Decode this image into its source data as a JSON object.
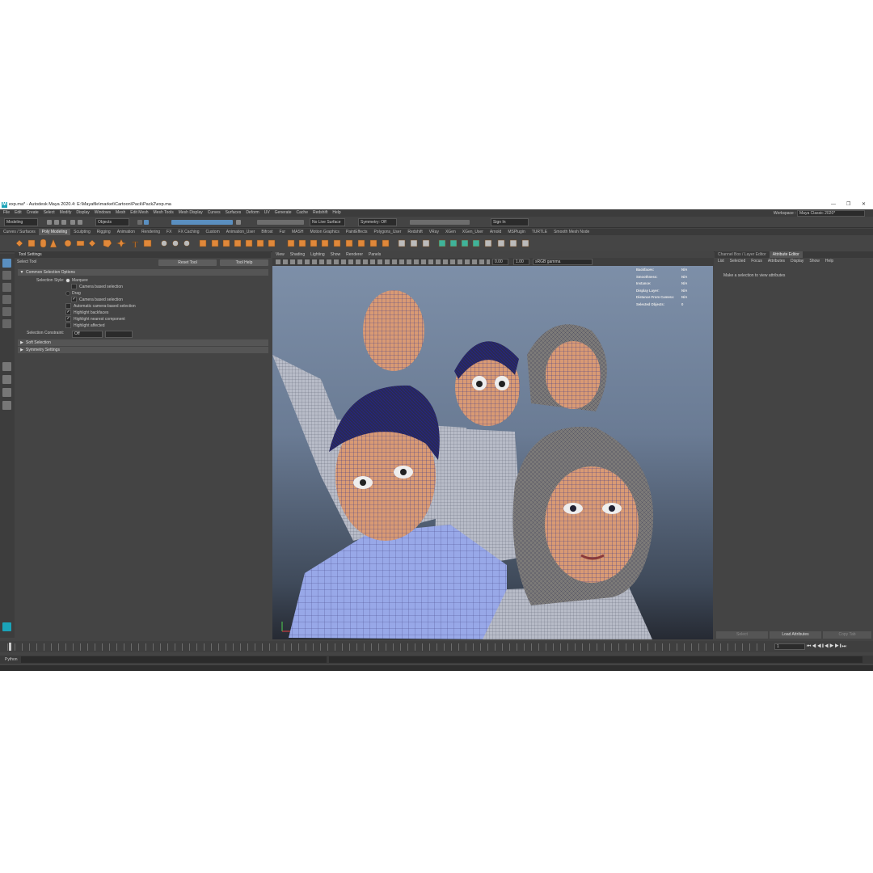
{
  "window": {
    "title": "exp.ma* - Autodesk Maya 2020.4: E:\\Mayafile\\market\\Cartoon\\Pack\\Pack2\\exp.ma",
    "logo": "M",
    "minimize": "—",
    "restore": "❐",
    "close": "✕"
  },
  "menu": [
    "File",
    "Edit",
    "Create",
    "Select",
    "Modify",
    "Display",
    "Windows",
    "Mesh",
    "Edit Mesh",
    "Mesh Tools",
    "Mesh Display",
    "Curves",
    "Surfaces",
    "Deform",
    "UV",
    "Generate",
    "Cache",
    "Redshift",
    "Help"
  ],
  "workspace": {
    "label": "Workspace :",
    "value": "Maya Classic 2020*"
  },
  "status": {
    "mode": "Modeling",
    "objects": "Objects",
    "live_surface": "No Live Surface",
    "symmetry": "Symmetry: Off",
    "sign_in": "Sign In"
  },
  "shelf_tabs": [
    "Curves / Surfaces",
    "Poly Modeling",
    "Sculpting",
    "Rigging",
    "Animation",
    "Rendering",
    "FX",
    "FX Caching",
    "Custom",
    "Animation_User",
    "Bifrost",
    "Fur",
    "MASH",
    "Motion Graphics",
    "PaintEffects",
    "Polygons_User",
    "Redshift",
    "VRay",
    "XGen",
    "XGen_User",
    "Arnold",
    "MSPlugin",
    "TURTLE",
    "Smooth Mesh Node"
  ],
  "active_shelf": "Poly Modeling",
  "tool_settings": {
    "panel_title": "Tool Settings",
    "tool_name": "Select Tool",
    "reset": "Reset Tool",
    "help": "Tool Help",
    "frame1": "Common Selection Options",
    "style_label": "Selection Style:",
    "opt_marquee": "Marquee",
    "opt_camera1": "Camera based selection",
    "opt_drag": "Drag",
    "opt_camera2": "Camera based selection",
    "opt_auto": "Automatic camera-based selection",
    "opt_backfaces": "Highlight backfaces",
    "opt_nearest": "Highlight nearest component",
    "opt_affected": "Highlight affected",
    "constraint_label": "Selection Constraint:",
    "constraint_value": "Off",
    "frame2": "Soft Selection",
    "frame3": "Symmetry Settings"
  },
  "viewport": {
    "menu": [
      "View",
      "Shading",
      "Lighting",
      "Show",
      "Renderer",
      "Panels"
    ],
    "exposure": "0.00",
    "gamma": "1.00",
    "colorspace": "sRGB gamma",
    "hud": [
      {
        "k": "Backfaces:",
        "v": "N/A"
      },
      {
        "k": "Smoothness:",
        "v": "N/A"
      },
      {
        "k": "Instance:",
        "v": "N/A"
      },
      {
        "k": "Display Layer:",
        "v": "N/A"
      },
      {
        "k": "Distance From Camera:",
        "v": "N/A"
      },
      {
        "k": "Selected Objects:",
        "v": "0"
      }
    ]
  },
  "attribute_editor": {
    "tabs": [
      "Channel Box / Layer Editor",
      "Attribute Editor"
    ],
    "menu": [
      "List",
      "Selected",
      "Focus",
      "Attributes",
      "Display",
      "Show",
      "Help"
    ],
    "empty_msg": "Make a selection to view attributes",
    "buttons": [
      "Select",
      "Load Attributes",
      "Copy Tab"
    ]
  },
  "timeline": {
    "current_frame": "1"
  },
  "command_line": {
    "lang": "Python"
  },
  "colors": {
    "accent": "#5a8fc0",
    "shelf_orange": "#e0883a",
    "viewport_top": "#7d8fa8"
  }
}
